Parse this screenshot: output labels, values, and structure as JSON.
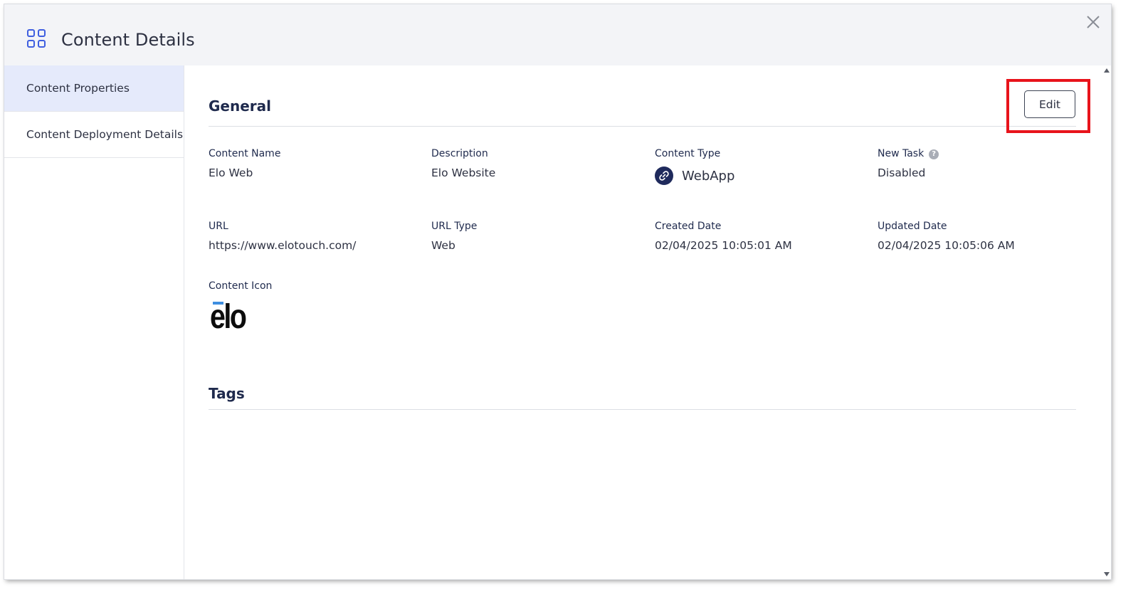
{
  "header": {
    "title": "Content Details"
  },
  "sidebar": {
    "items": [
      {
        "label": "Content Properties",
        "active": true
      },
      {
        "label": "Content Deployment Details",
        "active": false
      }
    ]
  },
  "general": {
    "title": "General",
    "edit_label": "Edit",
    "fields": {
      "content_name": {
        "label": "Content Name",
        "value": "Elo Web"
      },
      "description": {
        "label": "Description",
        "value": "Elo Website"
      },
      "content_type": {
        "label": "Content Type",
        "value": "WebApp",
        "icon": "link-icon"
      },
      "new_task": {
        "label": "New Task",
        "value": "Disabled",
        "help_icon": "question-icon"
      },
      "url": {
        "label": "URL",
        "value": "https://www.elotouch.com/"
      },
      "url_type": {
        "label": "URL Type",
        "value": "Web"
      },
      "created_date": {
        "label": "Created Date",
        "value": "02/04/2025 10:05:01 AM"
      },
      "updated_date": {
        "label": "Updated Date",
        "value": "02/04/2025 10:05:06 AM"
      },
      "content_icon": {
        "label": "Content Icon",
        "logo_text": "elo"
      }
    }
  },
  "tags": {
    "title": "Tags"
  },
  "colors": {
    "accent": "#1f2a4d",
    "header_bg": "#f3f4f7",
    "active_sidebar_bg": "#e5eafb",
    "highlight": "#e8131b",
    "logo_bar": "#3e8ee0"
  }
}
